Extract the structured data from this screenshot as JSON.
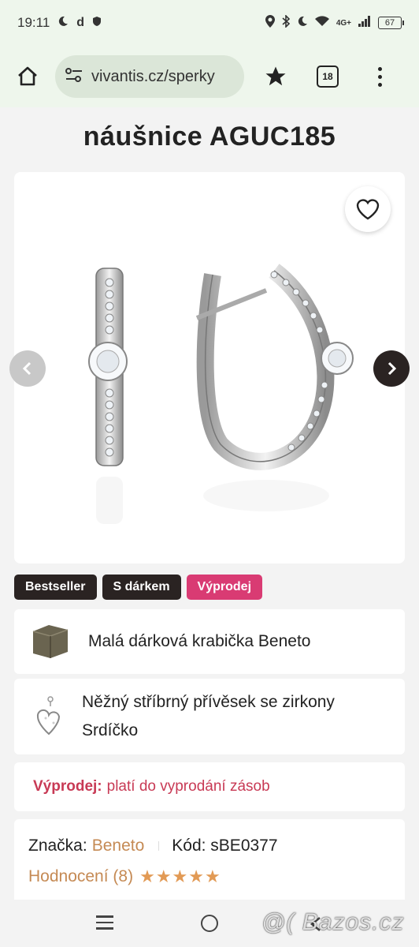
{
  "status_bar": {
    "time": "19:11",
    "network": "4G+",
    "battery": "67"
  },
  "browser": {
    "url": "vivantis.cz/sperky",
    "tab_count": "18"
  },
  "product": {
    "title": "náušnice AGUC185",
    "badges": [
      "Bestseller",
      "S dárkem",
      "Výprodej"
    ]
  },
  "gifts": [
    {
      "text": "Malá dárková krabička Beneto",
      "icon": "gift-box-image"
    },
    {
      "text": "Něžný stříbrný přívěsek se zirkony Srdíčko",
      "icon": "heart-pendant-image"
    }
  ],
  "sale": {
    "label": "Výprodej:",
    "text": "platí do vyprodání zásob"
  },
  "info": {
    "brand_label": "Značka:",
    "brand_value": "Beneto",
    "code_label": "Kód: sBE0377",
    "rating_label": "Hodnocení (8)",
    "rating_stars": 5
  },
  "watermark": "@( Bazos.cz",
  "colors": {
    "accent_pink": "#d93b73",
    "dark_badge": "#2a2322",
    "link_brown": "#c58a54",
    "sale_red": "#c83a55",
    "browser_bg": "#eef6ec"
  }
}
